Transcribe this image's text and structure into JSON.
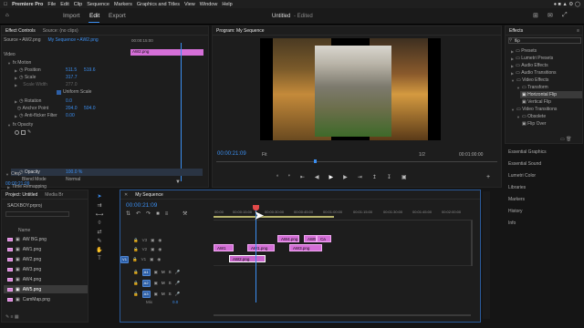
{
  "menubar": {
    "app": "Premiere Pro",
    "items": [
      "File",
      "Edit",
      "Clip",
      "Sequence",
      "Markers",
      "Graphics and Titles",
      "View",
      "Window",
      "Help"
    ]
  },
  "header": {
    "workspaces": [
      "Import",
      "Edit",
      "Export"
    ],
    "doc_title": "Untitled",
    "edited": "- Edited"
  },
  "effect_controls": {
    "tabs": [
      "Effect Controls",
      "Source: (no clips)"
    ],
    "source_line": "Source • AW2.png",
    "seq_line": "My Sequence • AW2.png",
    "mini_time": "00:00:15:00",
    "clip_chip": "AW2.png",
    "rows": {
      "video": "Video",
      "motion": "Motion",
      "position": "Position",
      "pos_x": "511.5",
      "pos_y": "519.6",
      "scale": "Scale",
      "scale_v": "317.7",
      "scale_w": "Scale Width",
      "scale_wv": "277.0",
      "uniform": "Uniform Scale",
      "rotation": "Rotation",
      "rot_v": "0.0",
      "anchor": "Anchor Point",
      "anc_x": "204.0",
      "anc_y": "504.0",
      "antiflicker": "Anti-flicker Filter",
      "af_v": "0.00",
      "opacity": "Opacity",
      "op_label": "Opacity",
      "op_v": "100.0 %",
      "blend": "Blend Mode",
      "blend_v": "Normal",
      "remap": "Time Remapping",
      "crop": "Crop"
    },
    "timecode": "00:00:21:09"
  },
  "program": {
    "title": "Program: My Sequence",
    "timecode": "00:00:21:09",
    "fit": "Fit",
    "fraction": "1/2",
    "duration": "00:01:00:00"
  },
  "effects_panel": {
    "title": "Effects",
    "search": "flip",
    "items": [
      "Presets",
      "Lumetri Presets",
      "Audio Effects",
      "Audio Transitions",
      "Video Effects",
      "Transform",
      "Horizontal Flip",
      "Vertical Flip",
      "Video Transitions",
      "Obsolete",
      "Flip Over"
    ],
    "sections": [
      "Essential Graphics",
      "Essential Sound",
      "Lumetri Color",
      "Libraries",
      "Markers",
      "History",
      "Info"
    ]
  },
  "project": {
    "tabs": [
      "Project: Untitled",
      "Media Br"
    ],
    "file": "SACKBOY.prproj",
    "col": "Name",
    "items": [
      "AW BG.png",
      "AW1.png",
      "AW2.png",
      "AW3.png",
      "AW4.png",
      "AW5.png",
      "CamMap.png"
    ]
  },
  "timeline": {
    "seq_title": "My Sequence",
    "timecode": "00:00:21:09",
    "ruler": [
      "00:00",
      "00:00:15:00",
      "00:00:30:00",
      "00:00:45:00",
      "00:01:00:00",
      "00:01:15:00",
      "00:01:30:00",
      "00:01:45:00",
      "00:02:00:00"
    ],
    "tracks": [
      "V3",
      "V2",
      "V1",
      "A1",
      "A2",
      "A3"
    ],
    "src": "V1",
    "mix": "Mix",
    "mix_v": "0.0",
    "clips": {
      "aw4": "AW4.png",
      "aw5": "AW5.png",
      "aw6": "Ca",
      "aw1": "AW1",
      "aw1b": "AW1.png",
      "aw3": "AW3.png",
      "aw2": "AW2.png"
    }
  },
  "colors": {
    "accent": "#3b8ef0",
    "clip": "#d56fd8",
    "playhead": "#e24a4a"
  }
}
